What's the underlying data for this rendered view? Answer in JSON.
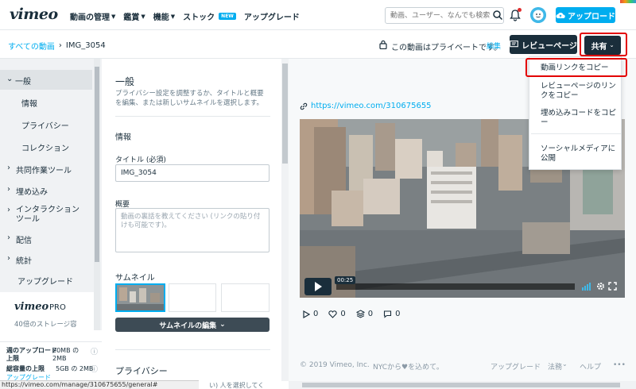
{
  "topbar": {
    "logo": "vimeo",
    "nav": [
      "動画の管理",
      "鑑賞",
      "機能",
      "ストック",
      "アップグレード"
    ],
    "new_badge": "NEW",
    "search_placeholder": "動画、ユーザー、なんでも検索",
    "upload_label": "アップロード"
  },
  "subbar": {
    "breadcrumb_root": "すべての動画",
    "breadcrumb_sep": "›",
    "breadcrumb_current": "IMG_3054",
    "private_text": "この動画はプライベートです。",
    "edit_label": "編集",
    "review_label": "レビューページ",
    "share_label": "共有"
  },
  "sidebar": {
    "items": [
      {
        "label": "一般",
        "prefix": "⌄"
      },
      {
        "label": "情報",
        "prefix": ""
      },
      {
        "label": "プライバシー",
        "prefix": ""
      },
      {
        "label": "コレクション",
        "prefix": ""
      },
      {
        "label": "共同作業ツール",
        "prefix": "›"
      },
      {
        "label": "埋め込み",
        "prefix": "›"
      },
      {
        "label": "インタラクションツール",
        "prefix": "›"
      },
      {
        "label": "配信",
        "prefix": "›"
      },
      {
        "label": "統計",
        "prefix": "›"
      },
      {
        "label": "アップグレード",
        "prefix": ""
      }
    ],
    "promo_logo": "vimeo",
    "promo_plan": "PRO",
    "promo_text": "40倍のストレージ容",
    "storage": {
      "weekly_label": "週のアップロード上限",
      "weekly_value": "20MB の 2MB",
      "total_label": "総容量の上限",
      "total_value": "5GB の 2MB",
      "upgrade_link": "アップグレード"
    }
  },
  "settings": {
    "section_title": "一般",
    "section_desc": "プライバシー設定を調整するか、タイトルと概要を編集、または新しいサムネイルを選択します。",
    "info_heading": "情報",
    "title_label": "タイトル (必須)",
    "title_value": "IMG_3054",
    "desc_label": "概要",
    "desc_placeholder": "動画の裏話を教えてください (リンクの貼り付けも可能です)。",
    "thumb_heading": "サムネイル",
    "thumb_edit_label": "サムネイルの編集",
    "privacy_heading": "プライバシー",
    "privacy_fragment": "い) 人を選択してく"
  },
  "preview": {
    "url": "https://vimeo.com/310675655",
    "timecode": "00:25",
    "stats": [
      {
        "icon": "play-icon",
        "value": "0"
      },
      {
        "icon": "heart-icon",
        "value": "0"
      },
      {
        "icon": "layers-icon",
        "value": "0"
      },
      {
        "icon": "comment-icon",
        "value": "0"
      }
    ],
    "footer": {
      "copyright": "© 2019 Vimeo, Inc.",
      "made_in": "NYCから♥を込めて。",
      "upgrade": "アップグレード",
      "legal": "法務",
      "help": "ヘルプ",
      "more": "•••"
    }
  },
  "share_menu": {
    "items": [
      "動画リンクをコピー",
      "レビューページのリンクをコピー",
      "埋め込みコードをコピー",
      "ソーシャルメディアに公開"
    ]
  },
  "statusbar": {
    "url": "https://vimeo.com/manage/310675655/general#"
  },
  "colors": {
    "accent": "#00adef",
    "dark": "#1a2e3b",
    "highlight": "#e30000"
  }
}
